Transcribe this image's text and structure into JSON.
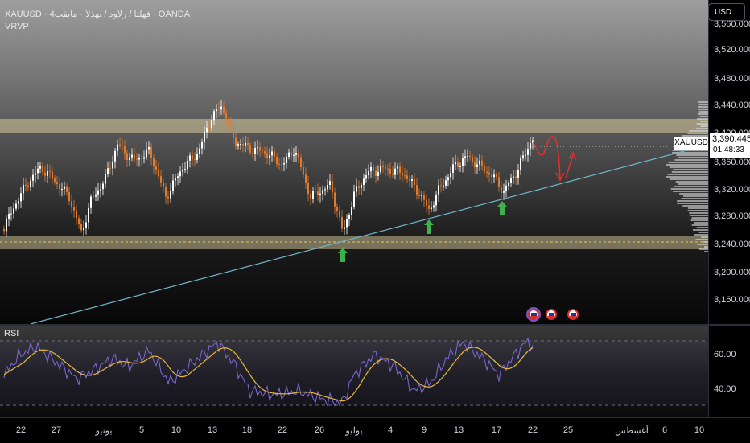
{
  "header": {
    "symbol_title": "XAUUSD · فهلتا / رلاود / بهذلا · مايقب4 · OANDA",
    "indicator": "VRVP",
    "currency_button": "USD"
  },
  "price_axis": {
    "labels": [
      "3,560.000",
      "3,520.000",
      "3,480.000",
      "3,440.000",
      "3,400.000",
      "3,360.000",
      "3,320.000",
      "3,280.000",
      "3,240.000",
      "3,200.000",
      "3,160.000"
    ]
  },
  "current_price": {
    "symbol": "XAUUSD",
    "value": "3,390.445",
    "countdown": "01:48:33"
  },
  "rsi": {
    "title": "RSI",
    "axis_labels": [
      "60.00",
      "40.00"
    ]
  },
  "time_axis": {
    "labels": [
      "22",
      "27",
      "يونيو",
      "5",
      "10",
      "13",
      "18",
      "22",
      "26",
      "يوليو",
      "4",
      "9",
      "13",
      "17",
      "22",
      "25",
      "أغسطس",
      "6",
      "10"
    ]
  },
  "colors": {
    "bull_candle": "#ffffff",
    "bear_candle": "#e07a2c",
    "trendline": "#6fb7c9",
    "zone": "#d7c99a",
    "rsi_line": "#7e6ad6",
    "rsi_ma": "#e8b93a",
    "buy_arrow": "#3fb04b",
    "projection": "#e03030"
  }
}
